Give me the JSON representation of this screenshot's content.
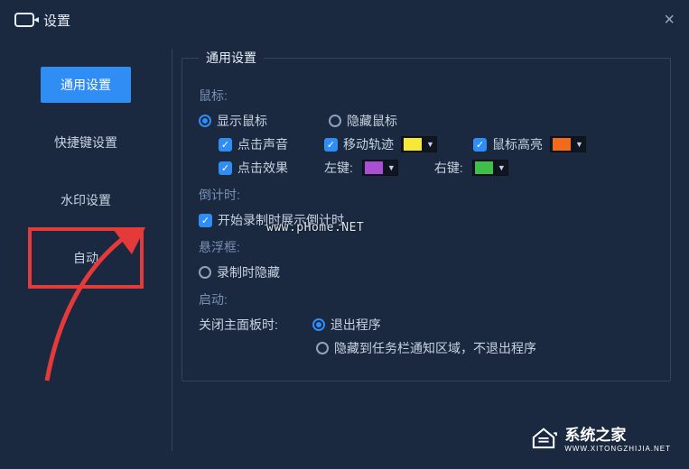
{
  "title": "设置",
  "sidebar": {
    "items": [
      {
        "label": "通用设置"
      },
      {
        "label": "快捷键设置"
      },
      {
        "label": "水印设置"
      },
      {
        "label": "自动"
      }
    ]
  },
  "group_legend": "通用设置",
  "mouse": {
    "section": "鼠标:",
    "show": "显示鼠标",
    "hide": "隐藏鼠标",
    "click_sound": "点击声音",
    "move_trail": "移动轨迹",
    "highlight": "鼠标高亮",
    "click_effect": "点击效果",
    "left_btn": "左键:",
    "right_btn": "右键:"
  },
  "countdown": {
    "section": "倒计时:",
    "start_show": "开始录制时展示倒计时"
  },
  "floating": {
    "section": "悬浮框:",
    "hide_on_record": "录制时隐藏"
  },
  "startup": {
    "section": "启动:",
    "close_label": "关闭主面板时:",
    "exit": "退出程序",
    "tray": "隐藏到任务栏通知区域，不退出程序"
  },
  "colors": {
    "trail": "#f7e838",
    "highlight": "#f26a1b",
    "left": "#a94fd1",
    "right": "#3fbf4a"
  },
  "watermark": "www.pHome.NET",
  "brand": {
    "cn": "系统之家",
    "en": "WWW.XITONGZHIJIA.NET"
  }
}
